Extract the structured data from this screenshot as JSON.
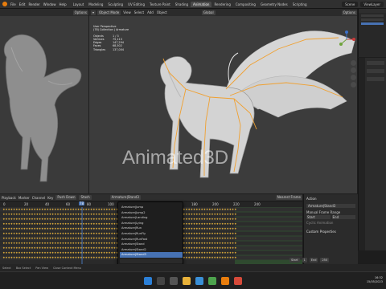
{
  "topbar": {
    "menus": [
      "File",
      "Edit",
      "Render",
      "Window",
      "Help"
    ],
    "workspaces": [
      "Layout",
      "Modeling",
      "Sculpting",
      "UV Editing",
      "Texture Paint",
      "Shading",
      "Animation",
      "Rendering",
      "Compositing",
      "Geometry Nodes",
      "Scripting"
    ],
    "active_workspace": "Animation",
    "scene": "Scene",
    "view_layer": "ViewLayer"
  },
  "left_viewport": {
    "options": "Options"
  },
  "main_viewport": {
    "mode": "Object Mode",
    "menus": [
      "View",
      "Select",
      "Add",
      "Object"
    ],
    "transform": "Global",
    "options": "Options",
    "info": {
      "perspective": "User Perspective",
      "collection": "(78) Collection | Armature",
      "objects_label": "Objects",
      "objects_value": "1 / 3",
      "vertices_label": "Vertices",
      "vertices_value": "75,113",
      "edges_label": "Edges",
      "edges_value": "147,294",
      "faces_label": "Faces",
      "faces_value": "68,502",
      "triangles_label": "Triangles",
      "triangles_value": "137,004"
    },
    "watermark": "Animated3D"
  },
  "timeline": {
    "header": [
      "Playback",
      "Marker",
      "Channel",
      "Key"
    ],
    "push_down": "Push Down",
    "stash": "Stash",
    "action_name": "Armature|Stand3",
    "nearest_frame": "Nearest Frame",
    "ruler": [
      "0",
      "20",
      "40",
      "60",
      "80",
      "100",
      "120",
      "140",
      "160",
      "180",
      "200",
      "220",
      "240"
    ],
    "current_frame": "78",
    "start_label": "Start",
    "start_value": "1",
    "end_label": "End",
    "end_value": "250"
  },
  "action_dropdown": {
    "items": [
      "Armature|Jump",
      "Armature|Jump2",
      "Armature|Landing",
      "Armature|Lying",
      "Armature|Run",
      "Armature|RunFly",
      "Armature|RunFast",
      "Armature|Stand",
      "Armature|Stand2",
      "Armature|Stand3"
    ],
    "selected": "Armature|Stand3"
  },
  "nla_sidebar": {
    "section_action": "Action",
    "action_field": "Armature|Stand3",
    "manual_frame_range": "Manual Frame Range",
    "start": "Start",
    "end": "End",
    "cyclic": "Cyclic Animation",
    "custom_properties": "Custom Properties"
  },
  "statusbar": {
    "items": [
      "Select",
      "Box Select",
      "Pan View",
      "Close Context Menu"
    ]
  },
  "taskbar": {
    "time": "16:32",
    "date": "15/05/2023"
  },
  "colors": {
    "accent": "#4772b3",
    "bone": "#f0a030",
    "keyframe_green": "#3d6b3d",
    "playhead": "#4772b3"
  }
}
